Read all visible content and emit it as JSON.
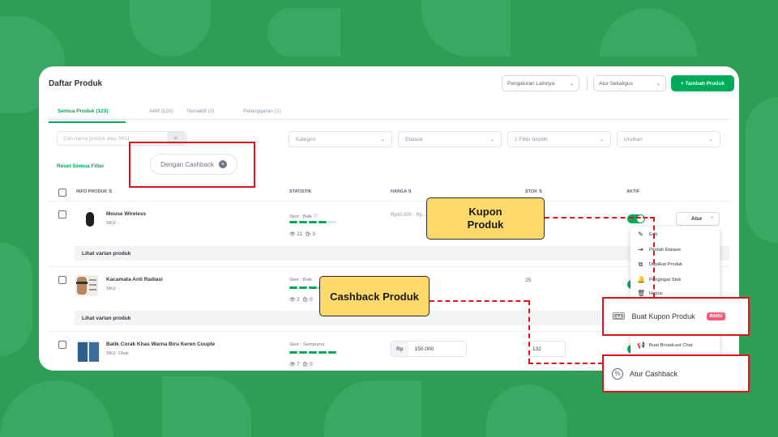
{
  "page_title": "Daftar Produk",
  "header": {
    "pengaturan_label": "Pengaturan Lainnya",
    "atur_sekaligus_label": "Atur Sekaligus",
    "tambah_label": "+ Tambah Produk"
  },
  "tabs": [
    {
      "label": "Semua Produk (123)"
    },
    {
      "label": "Aktif (120)"
    },
    {
      "label": "Nonaktif (2)"
    },
    {
      "label": "Pelanggaran (1)"
    }
  ],
  "filters": {
    "search_placeholder": "Cari nama produk atau SKU",
    "kategori": "Kategori",
    "etalase": "Etalase",
    "filter_terpilih": "1 Filter terpilih",
    "urutkan": "Urutkan",
    "reset_label": "Reset Semua Filter",
    "chip_label": "Dengan Cashback"
  },
  "table": {
    "headers": [
      "INFO PRODUK ⇅",
      "STATISTIK",
      "HARGA ⇅",
      "STOK ⇅",
      "AKTIF"
    ],
    "variant_label": "Lihat varian produk",
    "rows": [
      {
        "name": "Mouse Wireless",
        "sku": "SKU: -",
        "score": "Skor : Baik ⓘ",
        "views": "21",
        "sold": "0",
        "price": "Rp10.000 - Rp...",
        "stock": ""
      },
      {
        "name": "Kacamata Anti Radiasi",
        "sku": "SKU: -",
        "score": "Skor : Baik",
        "views": "2",
        "sold": "0",
        "price": "",
        "stock": "25"
      },
      {
        "name": "Batik Corak Khas Warna Biru Keren Couple",
        "sku": "SKU: 13we",
        "score": "Skor : Sempurna",
        "views": "7",
        "sold": "0",
        "price_prefix": "Rp",
        "price": "150.000",
        "stock": "132"
      }
    ]
  },
  "atur_button": "Atur",
  "menu": {
    "items": [
      "Edit",
      "Pindah Etalase",
      "Duplikat Produk",
      "Pengingat Stok",
      "Hapus"
    ],
    "buat_kupon": "Buat Kupon Produk",
    "baru_badge": "BARU",
    "broadcast": "Buat Broadcast Chat",
    "atur_cashback": "Atur Cashback"
  },
  "callouts": {
    "kupon": "Kupon Produk",
    "cashback": "Cashback Produk"
  },
  "colors": {
    "brand_green": "#00aa5b",
    "background": "#2e9e55",
    "callout_yellow": "#ffd96a",
    "highlight_red": "#e0131c"
  }
}
